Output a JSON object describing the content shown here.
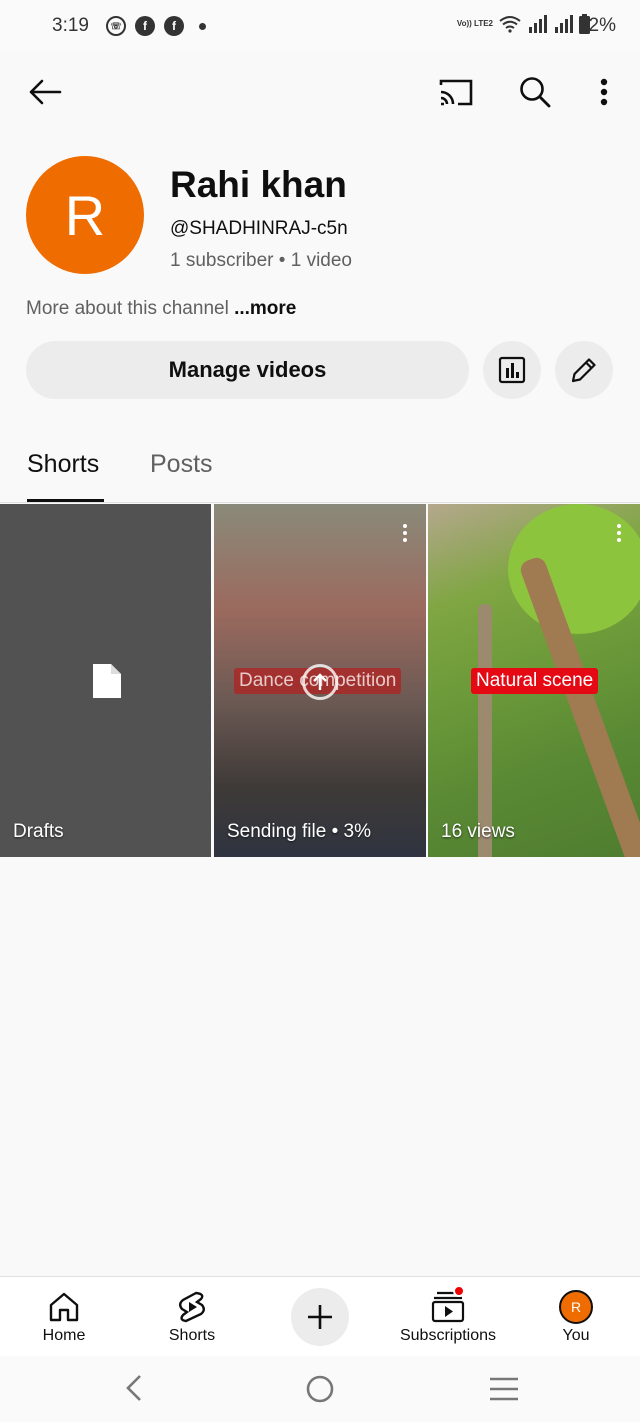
{
  "status_bar": {
    "time": "3:19",
    "network_label": "Vo)) LTE2",
    "battery": "92%"
  },
  "channel": {
    "avatar_letter": "R",
    "avatar_color": "#ef6c00",
    "name": "Rahi khan",
    "handle": "@SHADHINRAJ-c5n",
    "subscribers": "1 subscriber",
    "separator": "•",
    "videos": "1 video",
    "about_prefix": "More about this channel",
    "about_more": "...more"
  },
  "actions": {
    "manage_label": "Manage videos",
    "analytics_icon": "analytics-icon",
    "edit_icon": "pencil-icon"
  },
  "tabs": [
    {
      "label": "Shorts",
      "active": true
    },
    {
      "label": "Posts",
      "active": false
    }
  ],
  "shorts": [
    {
      "label": "Drafts",
      "title": ""
    },
    {
      "label": "Sending file • 3%",
      "title": "Dance competition"
    },
    {
      "label": "16 views",
      "title": "Natural scene"
    }
  ],
  "bottom_nav": {
    "home": "Home",
    "shorts": "Shorts",
    "subscriptions": "Subscriptions",
    "you": "You",
    "you_avatar_letter": "R"
  },
  "colors": {
    "accent_red": "#e50914",
    "orange": "#ef6c00"
  }
}
